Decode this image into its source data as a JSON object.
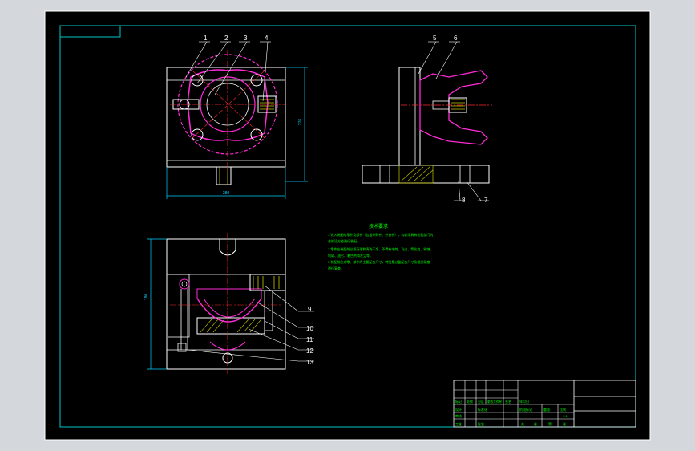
{
  "colors": {
    "background": "#d4d8dc",
    "sheet": "#000000",
    "frame": "#ffffff",
    "border": "#00c8c8",
    "outline": "#ffffff",
    "part": "#ff2bd6",
    "centerline": "#ff2a2a",
    "hatch": "#c8c800",
    "dimension": "#00d2ff",
    "leader": "#ffffff",
    "notes": "#00ff00"
  },
  "balloons_top_view": [
    "1",
    "2",
    "3",
    "4"
  ],
  "balloons_side_view": [
    "5",
    "6",
    "7",
    "8"
  ],
  "balloons_front_view": [
    "9",
    "10",
    "11",
    "12",
    "13"
  ],
  "dimensions": {
    "top_width": "280",
    "top_height": "276",
    "front_height": "180"
  },
  "notes": {
    "title": "技术要求",
    "lines": [
      "1.进入装配的零件及部件（包括外购件、外协件），均必须具有检验部门的",
      "合格证方能进行装配。",
      "2.零件在装配前必须清理和清洗干净，不得有毛刺、飞边、氧化皮、锈蚀、",
      "切屑、油污、着色剂和灰尘等。",
      "3.装配前应对零、部件的主要配合尺寸，特别是过盈配合尺寸及相关精度",
      "进行复查。"
    ]
  },
  "title_block": {
    "cells": [
      "标记",
      "处数",
      "分区",
      "更改文件号",
      "签名",
      "年月日",
      "设计",
      "标准化",
      "审核",
      "工艺",
      "批准",
      "阶段标记",
      "重量",
      "比例",
      "1:1",
      "共",
      "张",
      "第",
      "张"
    ]
  }
}
